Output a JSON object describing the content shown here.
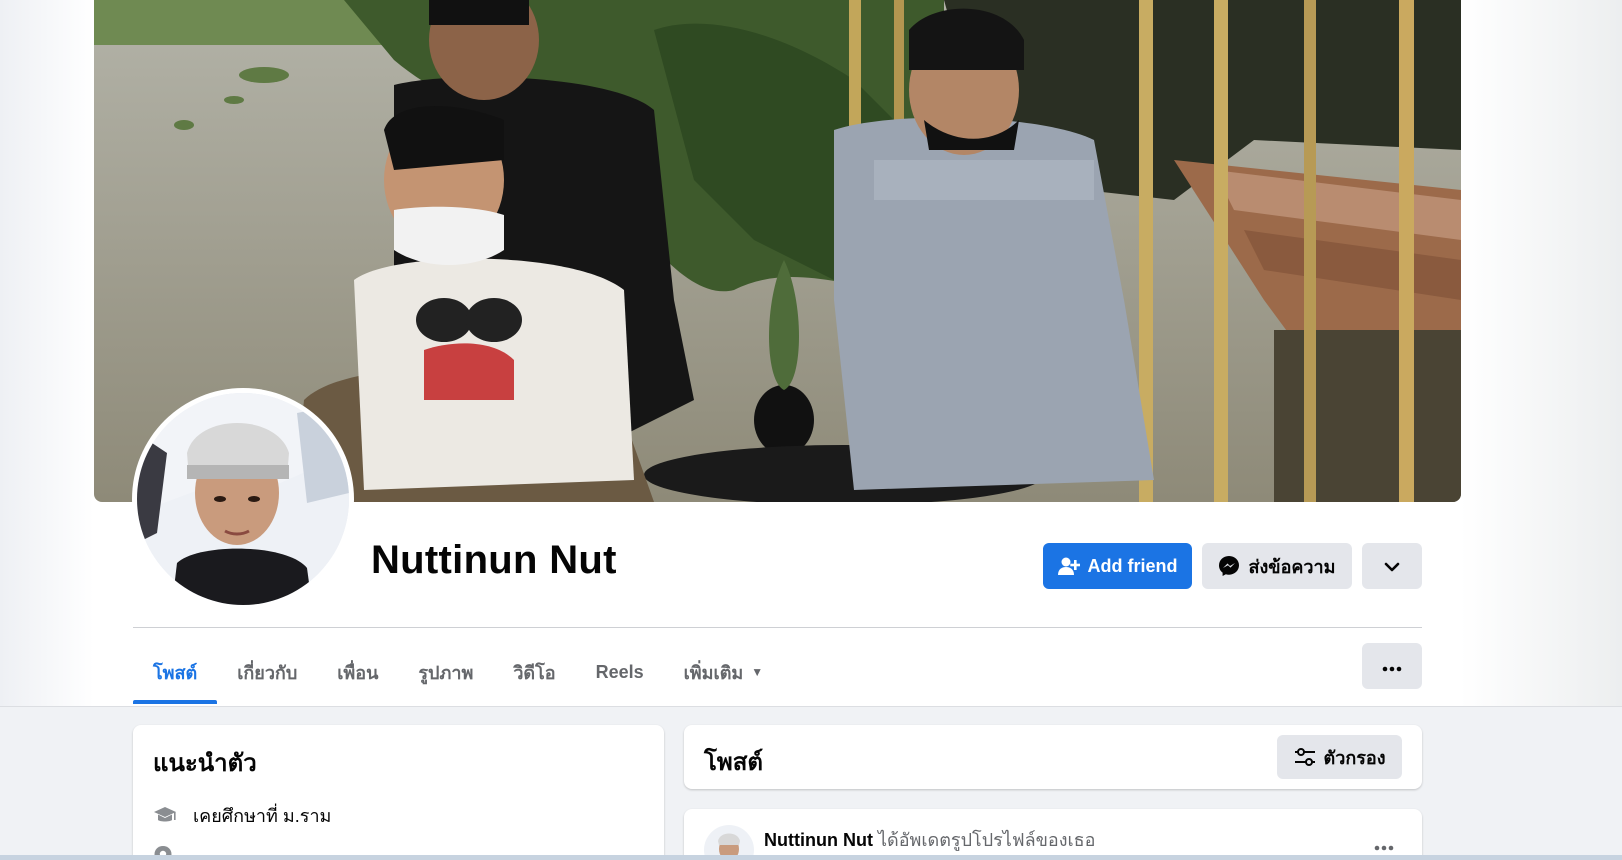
{
  "profile": {
    "name": "Nuttinun Nut"
  },
  "actions": {
    "add_friend": "Add friend",
    "message": "ส่งข้อความ"
  },
  "tabs": [
    {
      "label": "โพสต์",
      "active": true
    },
    {
      "label": "เกี่ยวกับ"
    },
    {
      "label": "เพื่อน"
    },
    {
      "label": "รูปภาพ"
    },
    {
      "label": "วิดีโอ"
    },
    {
      "label": "Reels"
    },
    {
      "label": "เพิ่มเติม"
    }
  ],
  "intro": {
    "title": "แนะนำตัว",
    "items": [
      {
        "icon": "graduation-cap-icon",
        "text": "เคยศึกษาที่ ม.ราม"
      },
      {
        "icon": "location-pin-icon",
        "text": ""
      }
    ]
  },
  "posts": {
    "title": "โพสต์",
    "filter_label": "ตัวกรอง",
    "items": [
      {
        "author": "Nuttinun Nut",
        "action": "ได้อัพเดตรูปโปรไฟล์ของเธอ"
      }
    ]
  },
  "colors": {
    "primary": "#1b74e4",
    "secondary_button": "#e4e6eb",
    "page_background": "#f0f2f5"
  }
}
